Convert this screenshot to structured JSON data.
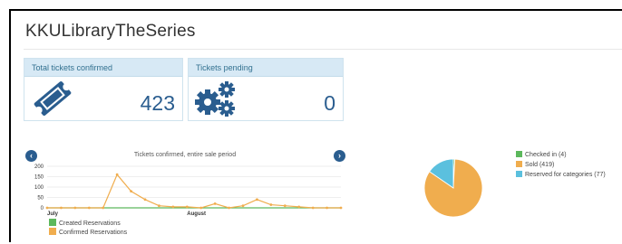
{
  "header": {
    "title": "KKULibraryTheSeries"
  },
  "cards": {
    "confirmed": {
      "label": "Total tickets confirmed",
      "value": "423",
      "icon": "ticket-icon"
    },
    "pending": {
      "label": "Tickets pending",
      "value": "0",
      "icon": "gears-icon"
    }
  },
  "nav": {
    "prev_icon": "chevron-left-icon",
    "next_icon": "chevron-right-icon"
  },
  "colors": {
    "accent": "#2a5d8f",
    "card_header_bg": "#d7e9f5",
    "created": "#5cb85c",
    "confirmed": "#f0ad4e",
    "reserved": "#5bc0de"
  },
  "chart_data": [
    {
      "type": "line",
      "title": "Tickets confirmed, entire sale period",
      "xlabel": "",
      "ylabel": "",
      "ylim": [
        0,
        200
      ],
      "y_ticks": [
        "200",
        "150",
        "100",
        "50",
        "0"
      ],
      "x_tick_labels": [
        {
          "label": "July",
          "index": 0
        },
        {
          "label": "August",
          "index": 10
        }
      ],
      "grid": true,
      "legend_position": "bottom-left",
      "series": [
        {
          "name": "Created Reservations",
          "color": "#5cb85c",
          "values": [
            0,
            0,
            0,
            0,
            0,
            0,
            0,
            0,
            0,
            0,
            0,
            0,
            0,
            0,
            0,
            0,
            0,
            0,
            0,
            0,
            0,
            0
          ]
        },
        {
          "name": "Confirmed Reservations",
          "color": "#f0ad4e",
          "values": [
            0,
            0,
            0,
            0,
            0,
            160,
            80,
            40,
            10,
            5,
            5,
            0,
            20,
            0,
            10,
            40,
            15,
            10,
            5,
            0,
            0,
            0
          ]
        }
      ]
    },
    {
      "type": "pie",
      "title": "",
      "legend_position": "right",
      "slices": [
        {
          "label": "Checked in (4)",
          "value": 4,
          "color": "#5cb85c"
        },
        {
          "label": "Sold (419)",
          "value": 419,
          "color": "#f0ad4e"
        },
        {
          "label": "Reserved for categories (77)",
          "value": 77,
          "color": "#5bc0de"
        }
      ]
    }
  ]
}
